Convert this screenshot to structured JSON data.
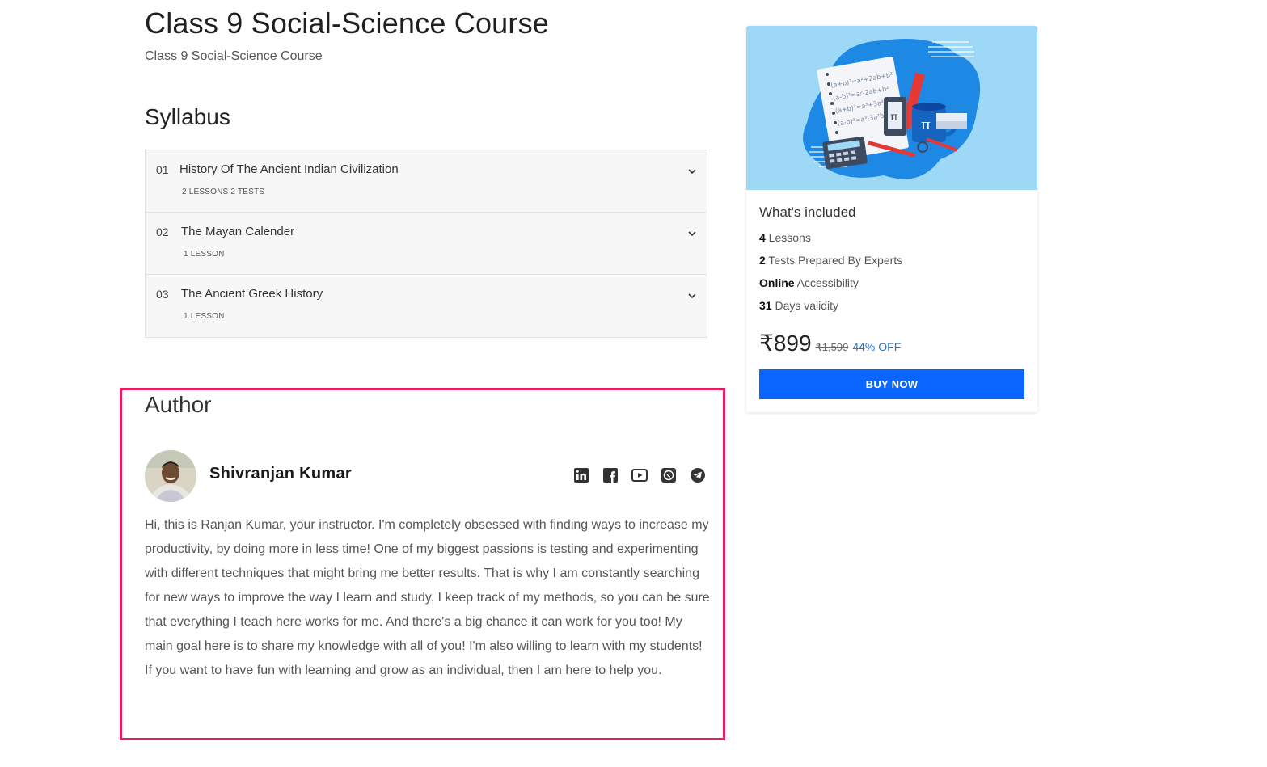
{
  "course": {
    "title": "Class 9 Social-Science Course",
    "subtitle": "Class 9 Social-Science Course"
  },
  "syllabus": {
    "heading": "Syllabus",
    "items": [
      {
        "num": "01",
        "title": "History Of The Ancient Indian Civilization",
        "meta": "2 LESSONS   2 TESTS"
      },
      {
        "num": "02",
        "title": "The Mayan Calender",
        "meta": "1 LESSON"
      },
      {
        "num": "03",
        "title": "The Ancient Greek History",
        "meta": "1 LESSON"
      }
    ]
  },
  "author": {
    "heading": "Author",
    "name": "Shivranjan Kumar",
    "bio": "Hi, this is Ranjan Kumar, your instructor.  I'm completely obsessed with finding ways to increase my productivity, by doing more in less time! One of my biggest passions is testing and experimenting with different techniques that might bring me better results. That is why I am constantly searching for new ways to improve the way I learn and study. I keep track of my methods, so you can be sure that everything I teach here works for me. And there's a big chance it can work for you too! My main goal here is to share my knowledge with all of you! I'm also willing to learn with my students! If you want to have fun with learning and grow as an individual, then I am here to help you.",
    "socials": [
      "linkedin-icon",
      "facebook-icon",
      "youtube-icon",
      "whatsapp-icon",
      "telegram-icon"
    ]
  },
  "card": {
    "included_title": "What's included",
    "items": [
      {
        "bold": "4",
        "text": " Lessons"
      },
      {
        "bold": "2",
        "text": " Tests Prepared By Experts"
      },
      {
        "bold": "Online",
        "text": " Accessibility"
      },
      {
        "bold": "31",
        "text": " Days validity"
      }
    ],
    "price": "₹899",
    "mrp": "₹1,599",
    "discount": "44% OFF",
    "buy_label": "BUY NOW"
  },
  "colors": {
    "highlight_border": "#ea1b63",
    "buy_button": "#0a66ff",
    "discount_text": "#1a73e8",
    "card_image_bg": "#9dd9f7"
  }
}
